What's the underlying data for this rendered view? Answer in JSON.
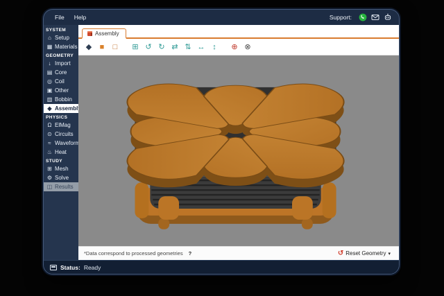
{
  "menu": {
    "items": [
      "File",
      "Help"
    ],
    "support_label": "Support:",
    "support_icons": [
      "whatsapp-icon",
      "email-icon",
      "bug-report-icon"
    ]
  },
  "tabs": [
    {
      "label": "Assembly",
      "icon": "assembly-cube-icon"
    }
  ],
  "toolbar": {
    "icons": [
      {
        "name": "shading-icon",
        "glyph": "◆",
        "color": "#2e3d52",
        "gap": false
      },
      {
        "name": "solid-color-icon",
        "glyph": "■",
        "color": "#d9822b",
        "gap": false
      },
      {
        "name": "wireframe-cube-icon",
        "glyph": "□",
        "color": "#c06820",
        "gap": false
      },
      {
        "name": "isometric-view-icon",
        "glyph": "⊞",
        "color": "#2e9a95",
        "gap": true
      },
      {
        "name": "rotate-left-icon",
        "glyph": "↺",
        "color": "#2e9a95",
        "gap": false
      },
      {
        "name": "rotate-right-icon",
        "glyph": "↻",
        "color": "#2e9a95",
        "gap": false
      },
      {
        "name": "flip-horizontal-icon",
        "glyph": "⇄",
        "color": "#2e9a95",
        "gap": false
      },
      {
        "name": "flip-vertical-icon",
        "glyph": "⇅",
        "color": "#2e9a95",
        "gap": false
      },
      {
        "name": "pan-horizontal-icon",
        "glyph": "↔",
        "color": "#2e9a95",
        "gap": false
      },
      {
        "name": "pan-vertical-icon",
        "glyph": "↕",
        "color": "#2e9a95",
        "gap": false
      },
      {
        "name": "zoom-fit-icon",
        "glyph": "⊕",
        "color": "#c0392b",
        "gap": true
      },
      {
        "name": "measure-icon",
        "glyph": "⊗",
        "color": "#4a4a4a",
        "gap": false
      }
    ]
  },
  "sidebar": {
    "sections": [
      {
        "header": "SYSTEM",
        "items": [
          {
            "label": "Setup",
            "icon": "home-icon",
            "glyph": "⌂"
          },
          {
            "label": "Materials",
            "icon": "materials-icon",
            "glyph": "▦"
          }
        ]
      },
      {
        "header": "GEOMETRY",
        "items": [
          {
            "label": "Import",
            "icon": "import-icon",
            "glyph": "↓"
          },
          {
            "label": "Core",
            "icon": "core-icon",
            "glyph": "▤"
          },
          {
            "label": "Coil",
            "icon": "coil-icon",
            "glyph": "◎"
          },
          {
            "label": "Other",
            "icon": "other-icon",
            "glyph": "▣"
          },
          {
            "label": "Bobbin",
            "icon": "bobbin-icon",
            "glyph": "▥"
          },
          {
            "label": "Assembly",
            "icon": "assembly-icon",
            "glyph": "◈",
            "selected": true
          }
        ]
      },
      {
        "header": "PHYSICS",
        "items": [
          {
            "label": "ElMag",
            "icon": "magnet-icon",
            "glyph": "Ω"
          },
          {
            "label": "Circuits",
            "icon": "circuit-icon",
            "glyph": "⊙"
          },
          {
            "label": "Waveform",
            "icon": "waveform-icon",
            "glyph": "≈"
          },
          {
            "label": "Heat",
            "icon": "thermometer-icon",
            "glyph": "♨"
          }
        ]
      },
      {
        "header": "STUDY",
        "items": [
          {
            "label": "Mesh",
            "icon": "mesh-icon",
            "glyph": "⊞"
          },
          {
            "label": "Solve",
            "icon": "solve-icon",
            "glyph": "⚙"
          },
          {
            "label": "Results",
            "icon": "results-icon",
            "glyph": "◫",
            "disabled": true
          }
        ]
      }
    ]
  },
  "viewport": {
    "model": "transformer-core-assembly",
    "colors": {
      "copper_top": "#c98434",
      "copper_side": "#7e4f16",
      "laminations": "#3b3b3b",
      "background": "#8a8a8a"
    }
  },
  "footer": {
    "note": "*Data correspond to processed geometries",
    "help_glyph": "?",
    "reset_icon_glyph": "↺",
    "reset_label": "Reset Geometry",
    "caret_glyph": "▾"
  },
  "status_bar": {
    "label": "Status:",
    "value": "Ready"
  }
}
